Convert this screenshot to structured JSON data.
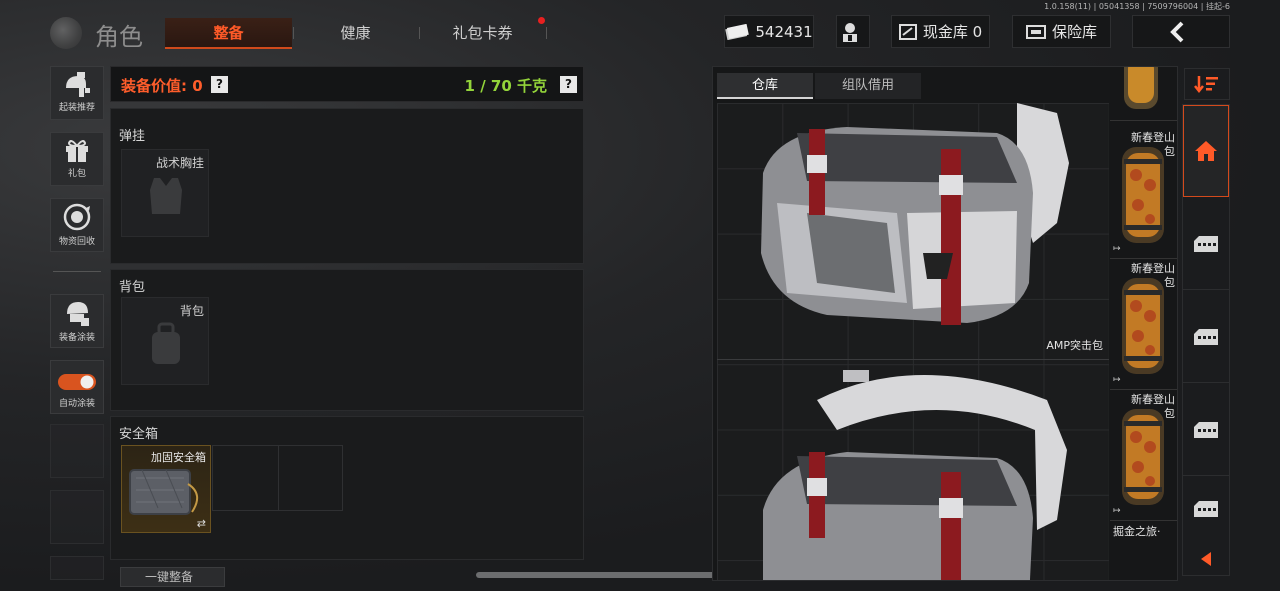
{
  "version_text": "1.0.158(11) | 05041358 | 7509796004 | 挂起-6",
  "title": "角色",
  "tabs": [
    {
      "label": "整备",
      "active": true
    },
    {
      "label": "健康",
      "active": false
    },
    {
      "label": "礼包卡券",
      "active": false,
      "notify": true
    }
  ],
  "currency": {
    "value": "542431",
    "icon": "banknote-icon"
  },
  "cash_vault": {
    "label": "现金库 0"
  },
  "safe_vault": {
    "label": "保险库"
  },
  "sidebar": [
    {
      "label": "起装推荐",
      "icon": "loadout-icon"
    },
    {
      "label": "礼包",
      "icon": "gift-icon"
    },
    {
      "label": "物资回收",
      "icon": "recycle-icon"
    },
    {
      "label": "装备涂装",
      "icon": "helmet-paint-icon"
    },
    {
      "label": "自动涂装",
      "icon": "toggle-icon",
      "toggle_on": true
    }
  ],
  "equip": {
    "value_label": "装备价值: 0",
    "weight_label": "1 / 70 千克",
    "help": "?"
  },
  "sections": {
    "rig": {
      "title": "弹挂",
      "slot_label": "战术胸挂"
    },
    "backpack": {
      "title": "背包",
      "slot_label": "背包"
    },
    "safebox": {
      "title": "安全箱",
      "slot_label": "加固安全箱",
      "swap_icon": "⇄"
    }
  },
  "bottom_button": {
    "label": "一键整备"
  },
  "storage": {
    "tabs": [
      {
        "label": "仓库",
        "active": true
      },
      {
        "label": "组队借用",
        "active": false
      }
    ],
    "big_items": [
      {
        "name": "AMP突击包"
      },
      {
        "name": ""
      }
    ],
    "small_items": [
      {
        "name": ""
      },
      {
        "name": "新春登山包"
      },
      {
        "name": "新春登山包"
      },
      {
        "name": "新春登山包"
      },
      {
        "name": "掘金之旅·"
      }
    ]
  },
  "colors": {
    "accent": "#ff5a28",
    "weight": "#93d43a"
  }
}
